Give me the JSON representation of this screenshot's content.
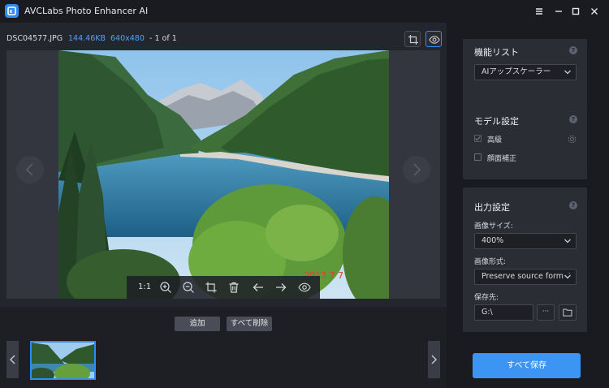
{
  "titlebar": {
    "app_title": "AVCLabs Photo Enhancer AI",
    "menu_icon": "hamburger-menu-icon",
    "minimize_icon": "minimize-icon",
    "maximize_icon": "maximize-icon",
    "close_icon": "close-icon"
  },
  "file_info": {
    "name": "DSC04577.JPG",
    "size": "144.46KB",
    "dimensions": "640x480",
    "counter": "- 1 of 1"
  },
  "preview": {
    "watermark_text": "2013  7  7",
    "toolbar": {
      "ratio_label": "1:1",
      "zoom_in_icon": "zoom-in-icon",
      "zoom_out_icon": "zoom-out-icon",
      "crop_icon": "crop-icon",
      "delete_icon": "trash-icon",
      "prev_icon": "arrow-left-icon",
      "next_icon": "arrow-right-icon",
      "preview_icon": "eye-icon"
    }
  },
  "list_controls": {
    "add_label": "追加",
    "remove_all_label": "すべて削除"
  },
  "panel": {
    "feature_list": {
      "title": "機能リスト",
      "selected": "AIアップスケーラー"
    },
    "model_settings": {
      "title": "モデル設定",
      "advanced_label": "高級",
      "advanced_checked": true,
      "face_label": "顔面補正",
      "face_checked": false
    },
    "output_settings": {
      "title": "出力設定",
      "image_size_label": "画像サイズ:",
      "image_size_value": "400%",
      "image_format_label": "画像形式:",
      "image_format_value": "Preserve source format",
      "save_to_label": "保存先:",
      "save_path": "G:\\",
      "browse_label": "···"
    },
    "save_all_label": "すべて保存"
  },
  "colors": {
    "accent": "#2f8cf0",
    "save_button": "#3d95f3",
    "size_text": "#4aa3f5",
    "dims_text": "#4aa3f5"
  }
}
